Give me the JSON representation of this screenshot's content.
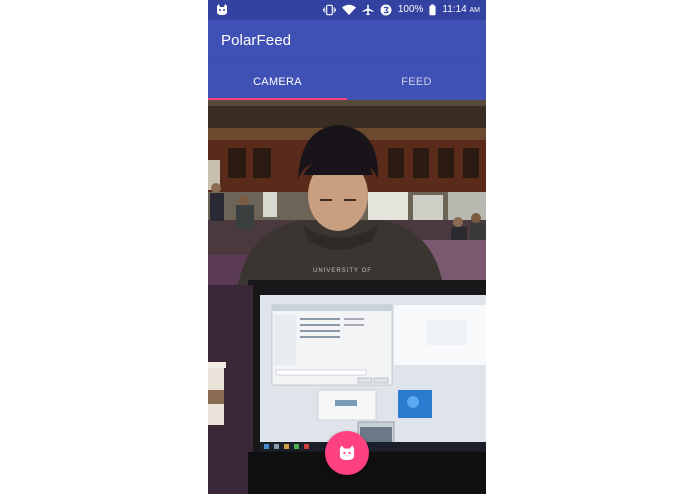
{
  "status_bar": {
    "notification_icon": "app-notification-icon",
    "vibrate_icon": "vibrate-icon",
    "wifi_icon": "wifi-icon",
    "airplane_icon": "airplane-mode-icon",
    "data_saver_icon": "data-saver-icon",
    "battery": "100%",
    "time": "11:14",
    "ampm": "AM"
  },
  "app_bar": {
    "title": "PolarFeed"
  },
  "tabs": [
    {
      "label": "CAMERA",
      "selected": true
    },
    {
      "label": "FEED",
      "selected": false
    }
  ],
  "camera": {
    "preview_icon": "camera-preview-image"
  },
  "fab": {
    "icon": "cat-face-icon"
  },
  "colors": {
    "status_bar": "#3342a0",
    "primary": "#3f51b5",
    "accent": "#ff4081"
  }
}
